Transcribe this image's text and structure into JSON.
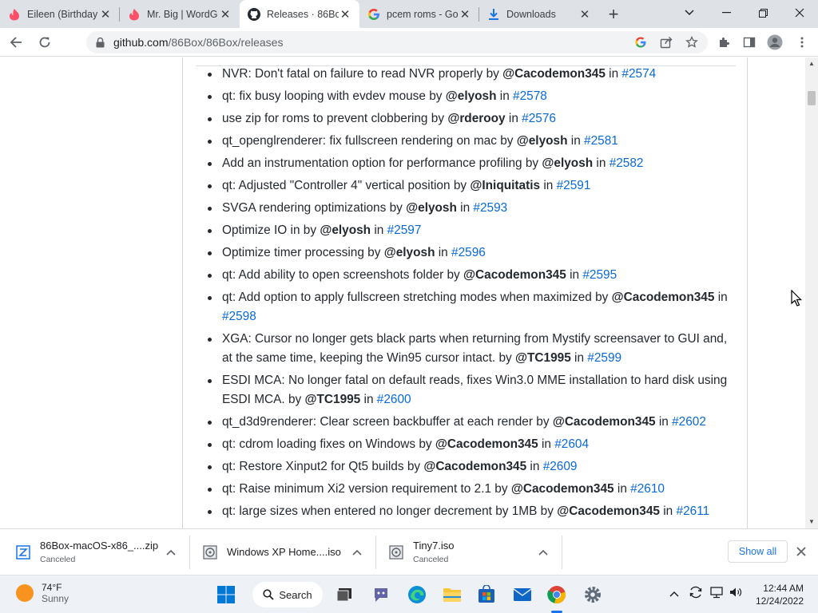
{
  "tabs": [
    {
      "title": "Eileen (Birthday",
      "icon": "tinder-icon"
    },
    {
      "title": "Mr. Big | WordG",
      "icon": "tinder-icon"
    },
    {
      "title": "Releases · 86Bo",
      "icon": "github-icon",
      "active": true
    },
    {
      "title": "pcem roms - Go",
      "icon": "google-icon"
    },
    {
      "title": "Downloads",
      "icon": "download-icon"
    }
  ],
  "address": {
    "host": "github.com",
    "path": "/86Box/86Box/releases"
  },
  "heading_fragment": "g",
  "changes": [
    {
      "text": "NVR: Don't fatal on failure to read NVR properly by ",
      "user": "@Cacodemon345",
      "mid": " in ",
      "pr": "#2574"
    },
    {
      "text": "qt: fix busy looping with evdev mouse by ",
      "user": "@elyosh",
      "mid": " in ",
      "pr": "#2578"
    },
    {
      "text": "use zip for roms to prevent clobbering by ",
      "user": "@rderooy",
      "mid": " in ",
      "pr": "#2576"
    },
    {
      "text": "qt_openglrenderer: fix fullscreen rendering on mac by ",
      "user": "@elyosh",
      "mid": " in ",
      "pr": "#2581"
    },
    {
      "text": "Add an instrumentation option for performance profiling by ",
      "user": "@elyosh",
      "mid": " in ",
      "pr": "#2582"
    },
    {
      "text": "qt: Adjusted \"Controller 4\" vertical position by ",
      "user": "@Iniquitatis",
      "mid": " in ",
      "pr": "#2591"
    },
    {
      "text": "SVGA rendering optimizations by ",
      "user": "@elyosh",
      "mid": " in ",
      "pr": "#2593"
    },
    {
      "text": "Optimize IO in by ",
      "user": "@elyosh",
      "mid": " in ",
      "pr": "#2597"
    },
    {
      "text": "Optimize timer processing by ",
      "user": "@elyosh",
      "mid": " in ",
      "pr": "#2596"
    },
    {
      "text": "qt: Add ability to open screenshots folder by ",
      "user": "@Cacodemon345",
      "mid": " in ",
      "pr": "#2595"
    },
    {
      "text": "qt: Add option to apply fullscreen stretching modes when maximized by ",
      "user": "@Cacodemon345",
      "mid": " in ",
      "pr": "#2598"
    },
    {
      "text": "XGA: Cursor no longer gets black parts when returning from Mystify screensaver to GUI and, at the same time, keeping the Win95 cursor intact. by ",
      "user": "@TC1995",
      "mid": " in ",
      "pr": "#2599"
    },
    {
      "text": "ESDI MCA: No longer fatal on default reads, fixes Win3.0 MME installation to hard disk using ESDI MCA. by ",
      "user": "@TC1995",
      "mid": " in ",
      "pr": "#2600"
    },
    {
      "text": "qt_d3d9renderer: Clear screen backbuffer at each render by ",
      "user": "@Cacodemon345",
      "mid": " in ",
      "pr": "#2602"
    },
    {
      "text": "qt: cdrom loading fixes on Windows by ",
      "user": "@Cacodemon345",
      "mid": " in ",
      "pr": "#2604"
    },
    {
      "text": "qt: Restore Xinput2 for Qt5 builds by ",
      "user": "@Cacodemon345",
      "mid": " in ",
      "pr": "#2609"
    },
    {
      "text": "qt: Raise minimum Xi2 version requirement to 2.1 by ",
      "user": "@Cacodemon345",
      "mid": " in ",
      "pr": "#2610"
    },
    {
      "text": "qt: large sizes when entered no longer decrement by 1MB by ",
      "user": "@Cacodemon345",
      "mid": " in ",
      "pr": "#2611"
    }
  ],
  "downloads": [
    {
      "name": "86Box-macOS-x86_....zip",
      "status": "Canceled"
    },
    {
      "name": "Windows XP Home....iso",
      "status": ""
    },
    {
      "name": "Tiny7.iso",
      "status": "Canceled"
    }
  ],
  "shelf": {
    "show_all": "Show all"
  },
  "taskbar": {
    "temp": "74°F",
    "condition": "Sunny",
    "search": "Search",
    "time": "12:44 AM",
    "date": "12/24/2022"
  },
  "colors": {
    "link": "#0969da",
    "text": "#24292f",
    "chrome_blue": "#1a73e8"
  }
}
